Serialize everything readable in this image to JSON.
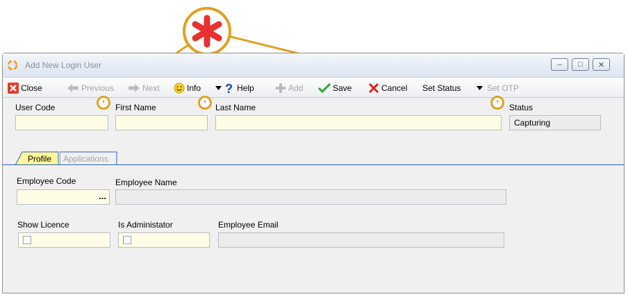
{
  "window": {
    "title": "Add New Login User",
    "controls": {
      "minimize": "–",
      "maximize": "□",
      "close": "✕"
    }
  },
  "toolbar": {
    "close": "Close",
    "previous": "Previous",
    "next": "Next",
    "info": "Info",
    "help": "Help",
    "add": "Add",
    "save": "Save",
    "cancel": "Cancel",
    "set_status": "Set Status",
    "set_otp": "Set OTP"
  },
  "fields": {
    "user_code": {
      "label": "User Code",
      "value": ""
    },
    "first_name": {
      "label": "First Name",
      "value": ""
    },
    "last_name": {
      "label": "Last Name",
      "value": ""
    },
    "status": {
      "label": "Status",
      "value": "Capturing"
    }
  },
  "tabs": [
    {
      "label": "Profile",
      "active": true
    },
    {
      "label": "Applications",
      "active": false
    }
  ],
  "profile": {
    "employee_code": {
      "label": "Employee Code",
      "value": "",
      "lookup": "..."
    },
    "employee_name": {
      "label": "Employee Name",
      "value": ""
    },
    "show_licence": {
      "label": "Show Licence",
      "checked": false
    },
    "is_administator": {
      "label": "Is Administator",
      "checked": false
    },
    "employee_email": {
      "label": "Employee Email",
      "value": ""
    }
  },
  "annotation": {
    "symbol": "*",
    "color": "#e0a020",
    "star_color": "#e83030"
  },
  "required_marker": "*",
  "colors": {
    "accent": "#2c62bb",
    "required_field": "#fffde6",
    "readonly_field": "#ececec"
  }
}
